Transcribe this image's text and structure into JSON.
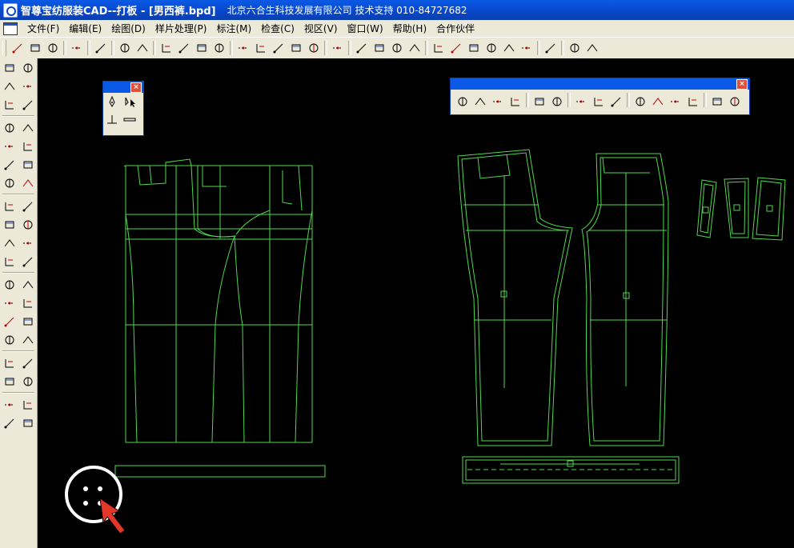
{
  "window": {
    "title": "智尊宝纺服装CAD--打板 - [男西裤.bpd]",
    "company": "北京六合生科技发展有限公司 技术支持 010-84727682"
  },
  "menu": {
    "items": [
      {
        "label": "文件(F)"
      },
      {
        "label": "编辑(E)"
      },
      {
        "label": "绘图(D)"
      },
      {
        "label": "样片处理(P)"
      },
      {
        "label": "标注(M)"
      },
      {
        "label": "检查(C)"
      },
      {
        "label": "视区(V)"
      },
      {
        "label": "窗口(W)"
      },
      {
        "label": "帮助(H)"
      },
      {
        "label": "合作伙伴"
      }
    ]
  },
  "toolbar": {
    "buttons": [
      "new-icon",
      "open-icon",
      "save-icon",
      "sep",
      "pattern-icon",
      "sep",
      "print-preview-icon",
      "sep",
      "print-icon",
      "preview-icon",
      "sep",
      "cut-icon",
      "copy-icon",
      "paste-icon",
      "delete-icon",
      "sep",
      "undo-icon",
      "redo-icon",
      "grade-icon",
      "grade2-icon",
      "measure-icon",
      "sep",
      "layer-icon",
      "sep",
      "curve-icon",
      "curve2-icon",
      "curve3-icon",
      "curve4-icon",
      "sep",
      "zoom-in-icon",
      "zoom-out-icon",
      "zoom-fit-icon",
      "zoom-window-icon",
      "zoom-prev-icon",
      "zoom-all-icon",
      "sep",
      "find-icon",
      "sep",
      "hand-icon",
      "person-icon"
    ]
  },
  "left_tools": [
    "point-icon",
    "pen-icon",
    "circle-icon",
    "rect-icon",
    "parallel-icon",
    "angle-icon",
    "sep",
    "dash-line-icon",
    "corner-icon",
    "cross-line-icon",
    "mirror-line-icon",
    "seam-icon",
    "seam2-icon",
    "select-icon",
    "measure-box-icon",
    "sep",
    "move-icon",
    "rotate-icon",
    "copy-piece-icon",
    "link-icon",
    "shape-icon",
    "corner-round-icon",
    "dart-icon",
    "triangle-icon",
    "sep",
    "fold-icon",
    "pleat-icon",
    "cut-piece-icon",
    "split-icon",
    "notch-icon",
    "curve-arc-icon",
    "hem-icon",
    "cuff-icon",
    "sep",
    "t-icon",
    "grid-icon",
    "target-icon",
    "text-icon",
    "sep",
    "ruler-icon",
    "stack-icon",
    "piece-list-icon",
    "piece-list2-icon"
  ],
  "panels": {
    "small": {
      "close_label": "×"
    },
    "large": {
      "close_label": "×"
    }
  },
  "colors": {
    "pattern_line": "#4fd84f",
    "canvas_bg": "#000000",
    "accent_red": "#e4362a"
  }
}
